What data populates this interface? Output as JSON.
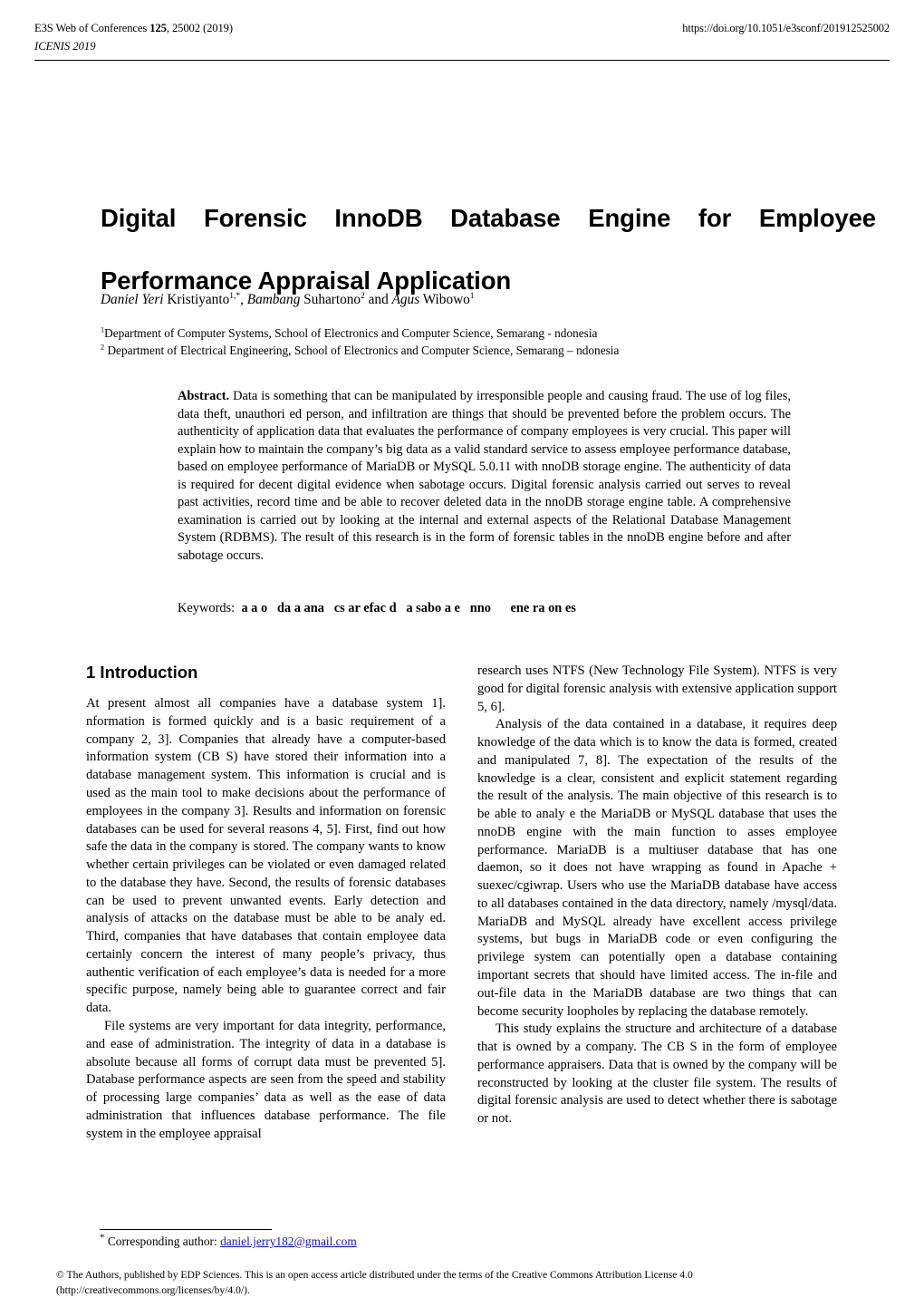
{
  "header": {
    "journal_line": "E3S Web of Conferences ",
    "volume": "125",
    "journal_line_rest": ", 25002 (2019)",
    "doi": "https://doi.org/10.1051/e3sconf/201912525002",
    "conference": "ICENIS 2019"
  },
  "title": {
    "line1": "Digital Forensic InnoDB Database Engine for Employee",
    "line2": "Performance Appraisal Application",
    "full": "Digital Forensic InnoDB Database Engine for Employee Performance Appraisal Application"
  },
  "authors": {
    "a1_first": "Daniel Yeri",
    "a1_last": " Kristiyanto",
    "a1_sup": "1,*",
    "sep1": ", ",
    "a2_first": "Bambang",
    "a2_last": " Suhartono",
    "a2_sup": "2",
    "sep2": " and ",
    "a3_first": "Agus",
    "a3_last": " Wibowo",
    "a3_sup": "1"
  },
  "affiliations": [
    {
      "sup": "1",
      "text": "Department of Computer Systems, School of Electronics and Computer Science, Semarang -  ndonesia"
    },
    {
      "sup": "2",
      "text": " Department of Electrical Engineering, School of Electronics and Computer Science, Semarang –  ndonesia"
    }
  ],
  "abstract": {
    "label": "Abstract.",
    "text": " Data is something that can be manipulated by irresponsible people and causing fraud. The use of log files, data theft, unauthori ed person, and infiltration are things that should be prevented before the problem occurs. The authenticity of application data that evaluates the performance of company employees is very crucial. This paper will explain how to maintain the company’s big data as a valid standard service to assess employee performance database, based on employee performance of MariaDB or MySQL 5.0.11 with  nnoDB storage engine. The authenticity of data is required for decent digital evidence when sabotage occurs. Digital forensic analysis carried out serves to reveal past activities, record time and be able to recover deleted data in the  nnoDB storage engine table. A comprehensive examination is carried out by looking at the internal and external aspects of the Relational Database Management System (RDBMS). The result of this research is in the form of forensic tables in the  nnoDB engine before and after sabotage occurs."
  },
  "keywords": {
    "label": "Keywords:",
    "list": "  a a o   da a ana   cs ar efac d   a sabo a e   nno      ene ra on es"
  },
  "body": {
    "section1_heading": "1 Introduction",
    "left_paragraphs": [
      "At present almost all companies have a database system  1].  nformation is formed quickly and is a basic requirement of a company  2, 3]. Companies that already have a computer-based information system (CB S) have stored their information into a database management system. This information is crucial and is used as the main tool to make decisions about the performance of employees in the company  3]. Results and information on forensic databases can be used for several reasons  4, 5]. First, find out how safe the data in the company is stored. The company wants to know whether certain privileges can be violated or even damaged related to the database they have. Second, the results of forensic databases can be used to prevent unwanted events. Early detection and analysis of attacks on the database must be able to be analy ed. Third, companies that have databases that contain employee data certainly concern the interest of many people’s privacy, thus authentic verification of each employee’s data is needed for a more specific purpose, namely being able to guarantee correct and fair data.",
      "File systems are very important for data integrity, performance, and ease of administration. The integrity of data in a database is absolute because all forms of corrupt data must be prevented  5]. Database performance aspects are seen from the speed and stability of processing large companies’ data as well as the ease of data administration that influences database performance. The file system in the employee appraisal"
    ],
    "right_paragraphs": [
      "research uses NTFS (New Technology File System). NTFS is very good for digital forensic analysis with extensive application support  5, 6].",
      "Analysis of the data contained in a database, it requires deep knowledge of the data which is to know the data is formed, created and manipulated  7, 8]. The expectation of the results of the knowledge is a clear, consistent and explicit statement regarding the result of the analysis. The main objective of this research is to be able to analy e the MariaDB or MySQL database that uses the  nnoDB engine with the main function to asses employee performance. MariaDB is a multiuser database that has one daemon, so it does not have wrapping as found in Apache + suexec/cgiwrap. Users who use the MariaDB database have access to all databases contained in the data directory, namely /mysql/data. MariaDB and MySQL already have excellent access privilege systems, but bugs in MariaDB code or even configuring the privilege system can potentially open a database containing important secrets that should have limited access. The in-file and out-file data in the MariaDB database are two things that can become security loopholes by replacing the database remotely.",
      "This study explains the structure and architecture of a database that is owned by a company. The CB S in the form of employee performance appraisers. Data that is owned by the company will be reconstructed by looking at the cluster file system. The results of digital forensic analysis are used to detect whether there is sabotage or not."
    ]
  },
  "footnote": {
    "marker": "*",
    "label": " Corresponding author: ",
    "email": "daniel.jerry182@gmail.com"
  },
  "copyright": {
    "line1": "© The Authors, published by EDP Sciences. This is an open access article distributed under the terms of the Creative Commons Attribution License 4.0",
    "line2": "(http://creativecommons.org/licenses/by/4.0/)."
  },
  "colors": {
    "text": "#000000",
    "link": "#1414d2",
    "page_background": "#ffffff"
  }
}
